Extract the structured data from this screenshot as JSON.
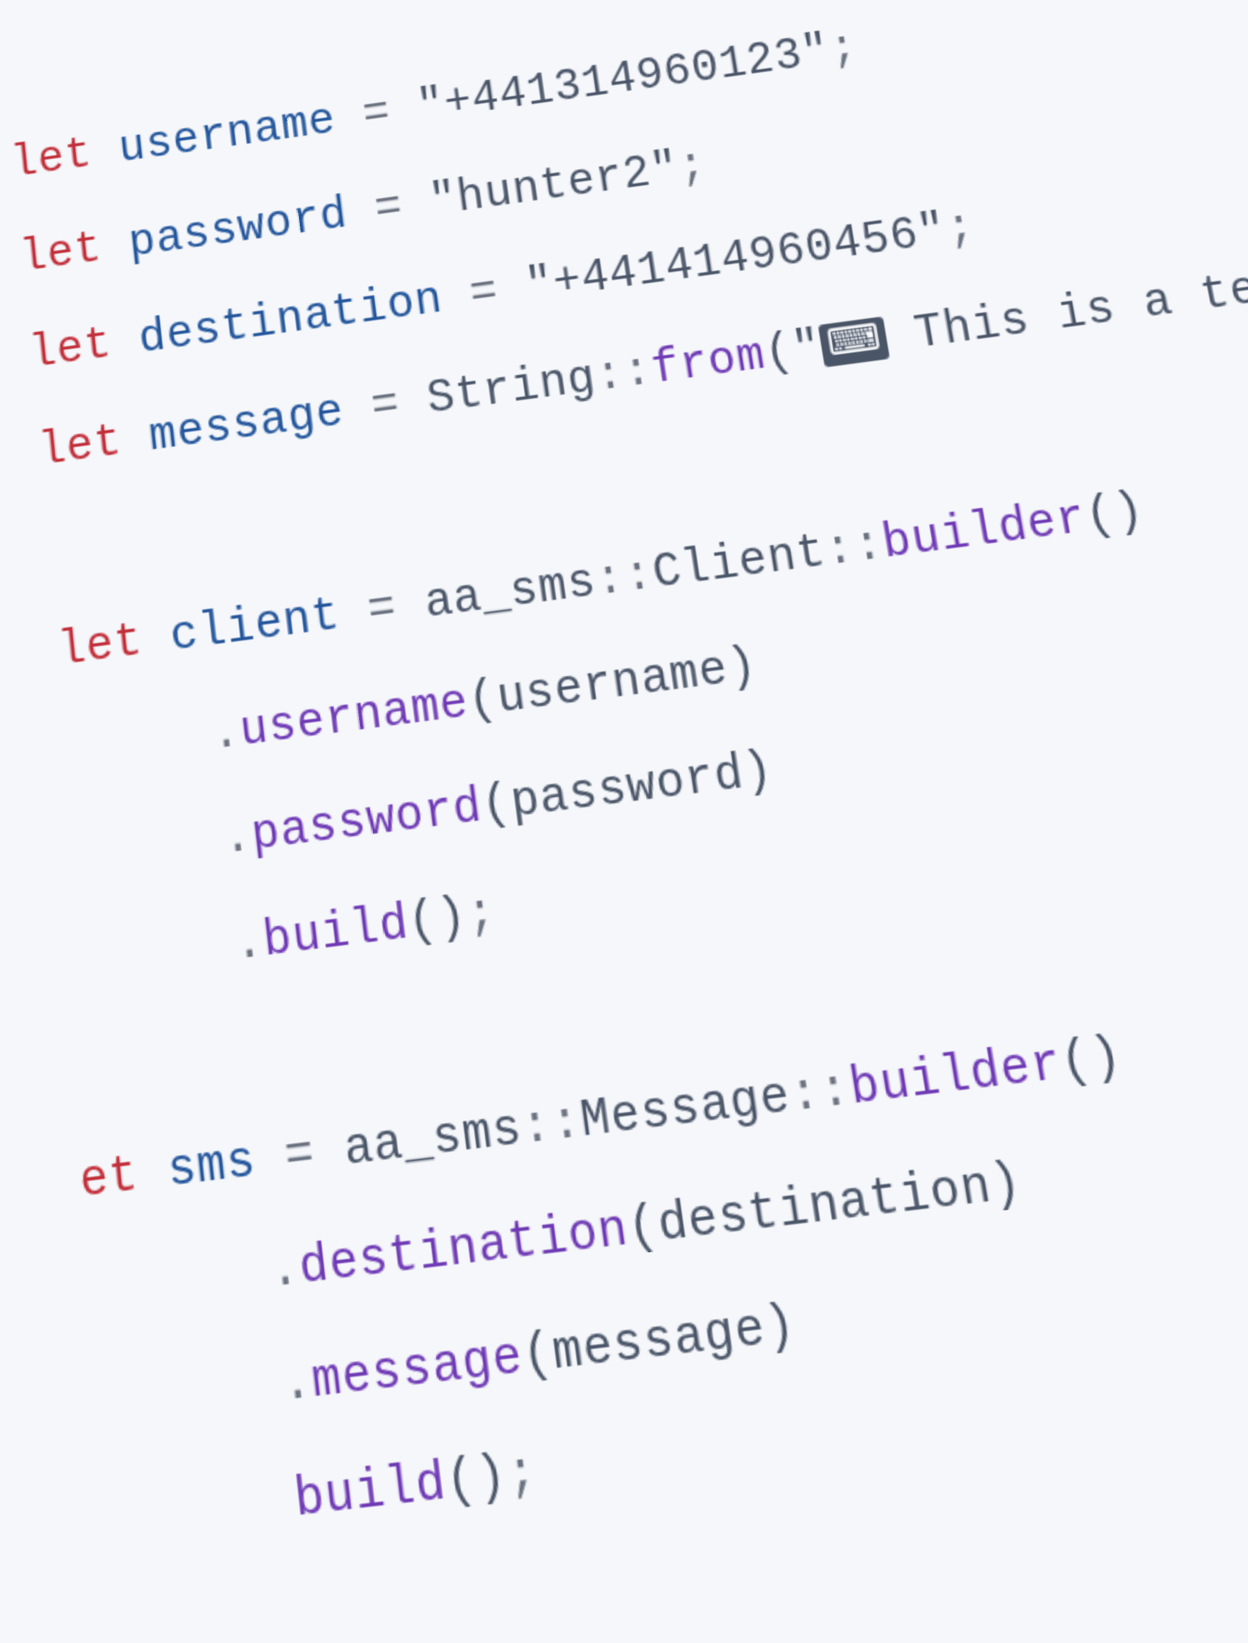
{
  "code": {
    "kw": "let",
    "vars": {
      "username": "username",
      "password": "password",
      "destination": "destination",
      "message": "message",
      "client": "client",
      "sms": "sms"
    },
    "strings": {
      "username_val": "\"+441314960123\"",
      "password_val": "\"hunter2\"",
      "destination_val": "\"+441414960456\"",
      "message_val_before_emoji": "\"",
      "message_emoji": "⌨",
      "message_val_after_emoji": " This is a test!"
    },
    "types": {
      "string": "String",
      "aa_sms": "aa_sms",
      "client": "Client",
      "message": "Message"
    },
    "methods": {
      "from": "from",
      "builder": "builder",
      "username": "username",
      "password": "password",
      "build": "build",
      "destination": "destination",
      "message": "message"
    },
    "punct": {
      "eq": " = ",
      "semi": ";",
      "dot": ".",
      "dcolon": "::",
      "lp": "(",
      "rp": ")",
      "emptyp": "()"
    },
    "partial_et": "et"
  }
}
